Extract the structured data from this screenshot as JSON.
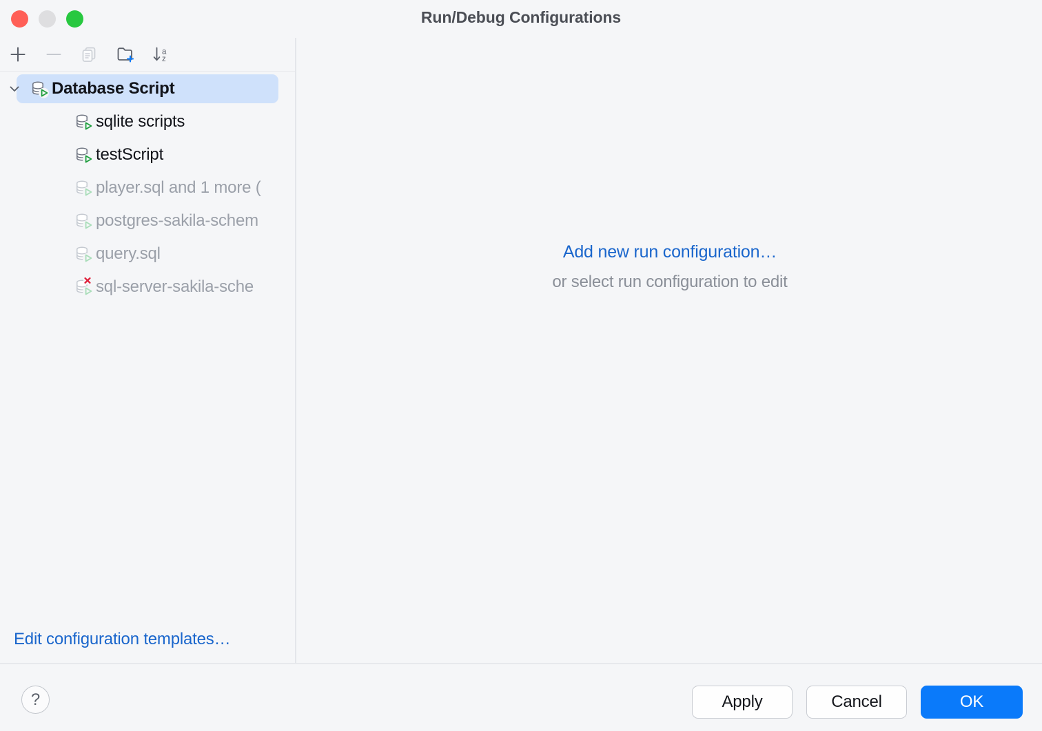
{
  "window": {
    "title": "Run/Debug Configurations",
    "traffic_lights": [
      {
        "name": "close",
        "color": "#ff5f57"
      },
      {
        "name": "minimize",
        "color": "#dedee0"
      },
      {
        "name": "maximize",
        "color": "#28c840"
      }
    ]
  },
  "toolbar": {
    "buttons": [
      {
        "icon": "plus-icon",
        "label": "Add New Configuration",
        "enabled": true
      },
      {
        "icon": "minus-icon",
        "label": "Remove Configuration",
        "enabled": false
      },
      {
        "icon": "copy-icon",
        "label": "Copy Configuration",
        "enabled": false
      },
      {
        "icon": "new-folder-icon",
        "label": "Create New Folder",
        "enabled": true
      },
      {
        "icon": "sort-alphabetically-icon",
        "label": "Sort Configurations",
        "enabled": true
      }
    ]
  },
  "tree": {
    "items": [
      {
        "label": "Database Script",
        "icon": "database-script-run-icon",
        "type": "group",
        "expanded": true,
        "selected": true,
        "muted": false,
        "error": false
      },
      {
        "label": "sqlite scripts",
        "icon": "database-script-run-icon",
        "type": "configuration",
        "selected": false,
        "muted": false,
        "error": false
      },
      {
        "label": "testScript",
        "icon": "database-script-run-icon",
        "type": "configuration",
        "selected": false,
        "muted": false,
        "error": false
      },
      {
        "label": "player.sql and 1 more (",
        "icon": "database-script-run-icon",
        "type": "temporary-configuration",
        "selected": false,
        "muted": true,
        "error": false
      },
      {
        "label": "postgres-sakila-schem",
        "icon": "database-script-run-icon",
        "type": "temporary-configuration",
        "selected": false,
        "muted": true,
        "error": false
      },
      {
        "label": "query.sql",
        "icon": "database-script-run-icon",
        "type": "temporary-configuration",
        "selected": false,
        "muted": true,
        "error": false
      },
      {
        "label": "sql-server-sakila-sche",
        "icon": "database-script-run-error-icon",
        "type": "temporary-configuration",
        "selected": false,
        "muted": true,
        "error": true
      }
    ]
  },
  "left_panel": {
    "edit_templates_label": "Edit configuration templates…"
  },
  "main": {
    "add_new_label": "Add new run configuration…",
    "hint_label": "or select run configuration to edit"
  },
  "footer": {
    "help_label": "?",
    "apply_label": "Apply",
    "cancel_label": "Cancel",
    "ok_label": "OK"
  },
  "colors": {
    "accent_blue": "#0a7afa",
    "link_blue": "#1a66cc",
    "selection_blue": "#cfe1fb",
    "background": "#f5f6f8",
    "muted_text": "#9ba0a9",
    "icon_green": "#1e9e3e",
    "icon_red": "#e0203a"
  }
}
